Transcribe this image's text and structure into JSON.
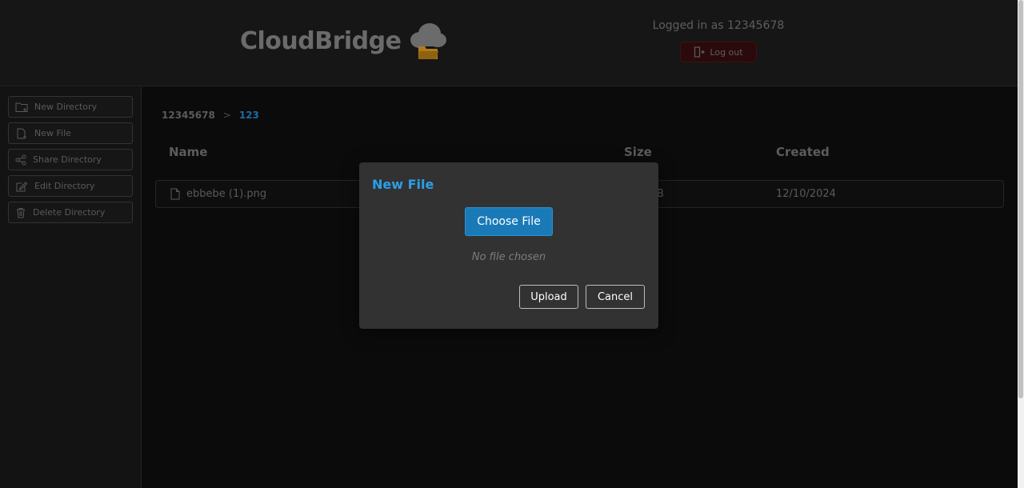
{
  "header": {
    "brand_name": "CloudBridge",
    "user_text": "Logged in as 12345678",
    "logout_label": "Log out"
  },
  "sidebar": {
    "items": [
      {
        "label": "New Directory",
        "icon": "folder-plus-icon"
      },
      {
        "label": "New File",
        "icon": "file-plus-icon"
      },
      {
        "label": "Share Directory",
        "icon": "share-icon"
      },
      {
        "label": "Edit Directory",
        "icon": "edit-icon"
      },
      {
        "label": "Delete Directory",
        "icon": "trash-icon"
      }
    ]
  },
  "breadcrumb": {
    "root": "12345678",
    "separator": ">",
    "current": "123"
  },
  "table": {
    "columns": [
      "Name",
      "Size",
      "Created"
    ],
    "rows": [
      {
        "name": "ebbebe (1).png",
        "size": "B",
        "created": "12/10/2024"
      }
    ]
  },
  "modal": {
    "title": "New File",
    "choose_label": "Choose File",
    "no_file_text": "No file chosen",
    "upload_label": "Upload",
    "cancel_label": "Cancel"
  },
  "colors": {
    "accent": "#2a9fe8",
    "button_blue": "#1a7ab8",
    "logout_bg": "#2a0a0a"
  }
}
